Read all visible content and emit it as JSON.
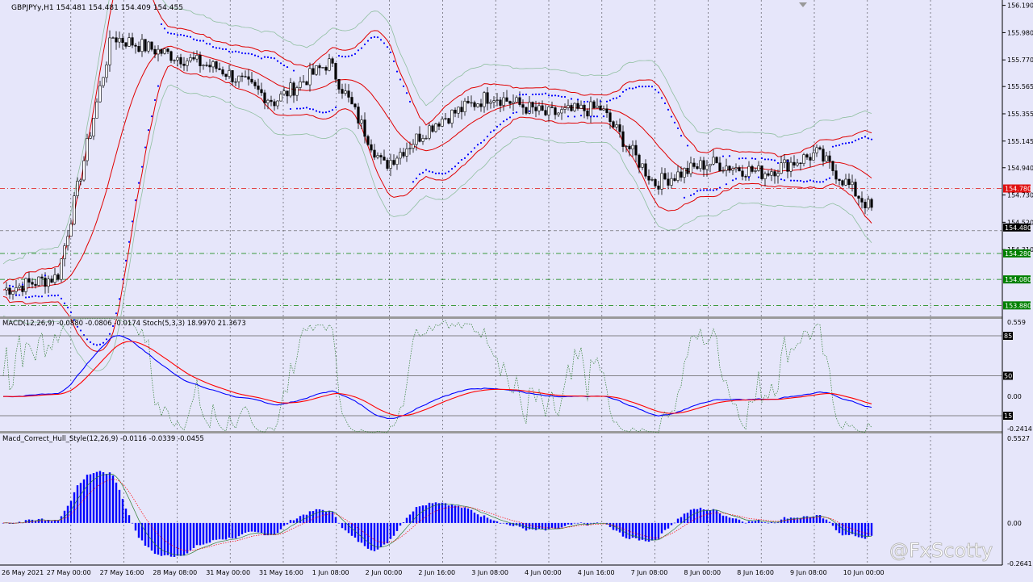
{
  "colors": {
    "background": "#e6e6fa",
    "bull_candle": "#ffffff",
    "bear_candle": "#000000",
    "bollinger_mid": "#e00000",
    "envelope": "#8fbf9f",
    "psar": "#0000ff",
    "macd_main": "#0000ff",
    "macd_signal": "#ff0000",
    "stoch": "#2e7d32",
    "hist": "#0000ff",
    "level_red": "#e01010",
    "level_green": "#008000",
    "grid": "#000000"
  },
  "icons": {
    "chart_shift_marker": "triangle-down-icon"
  },
  "main_panel": {
    "title": "GBPJPYy,H1  154.481 154.481 154.409 154.455",
    "price_axis": [
      "156.190",
      "155.980",
      "155.770",
      "155.565",
      "155.355",
      "155.145",
      "154.940",
      "154.730",
      "154.520",
      "154.310"
    ],
    "price_axis_values": [
      156.19,
      155.98,
      155.77,
      155.565,
      155.355,
      155.145,
      154.94,
      154.73,
      154.52,
      154.31
    ],
    "current_price": "154.480",
    "current_price_value": 154.48,
    "levels": [
      {
        "label": "154.780",
        "value": 154.78,
        "color": "#e01010",
        "style": "dashdot"
      },
      {
        "label": "154.280",
        "value": 154.28,
        "color": "#008000",
        "style": "dashdot"
      },
      {
        "label": "154.080",
        "value": 154.08,
        "color": "#008000",
        "style": "dashdot"
      },
      {
        "label": "153.880",
        "value": 153.88,
        "color": "#008000",
        "style": "dashdot"
      }
    ],
    "bid_line_value": 154.455,
    "ylim": [
      153.82,
      156.2
    ]
  },
  "macd_panel": {
    "title": "MACD(12,26,9) -0.0880 -0.0806 -0.0174  Stoch(5,3,3) 18.9970 21.3673",
    "axis_labels": [
      {
        "text": "0.559",
        "value": 0.559
      },
      {
        "text": "0.00",
        "value": 0.0
      },
      {
        "text": "-0.2414",
        "value": -0.2414
      }
    ],
    "stoch_levels": [
      {
        "text": "85",
        "value": 85
      },
      {
        "text": "50",
        "value": 50
      },
      {
        "text": "15",
        "value": 15
      }
    ],
    "ylim": [
      -0.2414,
      0.559
    ]
  },
  "hull_panel": {
    "title": "Macd_Correct_Hull_Style(12,26,9) -0.0116 -0.0339 -0.0455",
    "axis_labels": [
      {
        "text": "0.5527",
        "value": 0.5527
      },
      {
        "text": "0.00",
        "value": 0.0
      },
      {
        "text": "-0.2641",
        "value": -0.2641
      }
    ],
    "ylim": [
      -0.2641,
      0.5527
    ]
  },
  "time_axis": [
    "26 May 2021",
    "27 May 00:00",
    "27 May 16:00",
    "28 May 08:00",
    "31 May 00:00",
    "31 May 16:00",
    "1 Jun 08:00",
    "2 Jun 00:00",
    "2 Jun 16:00",
    "3 Jun 08:00",
    "4 Jun 00:00",
    "4 Jun 16:00",
    "7 Jun 08:00",
    "8 Jun 00:00",
    "8 Jun 16:00",
    "9 Jun 08:00",
    "10 Jun 00:00"
  ],
  "watermark": "@FxScotty",
  "chart_data": {
    "type": "line",
    "title": "GBPJPYy,H1  154.481 154.481 154.409 154.455",
    "x": [
      "26 May 2021",
      "27 May 00:00",
      "27 May 16:00",
      "28 May 08:00",
      "31 May 00:00",
      "31 May 16:00",
      "1 Jun 08:00",
      "2 Jun 00:00",
      "2 Jun 16:00",
      "3 Jun 08:00",
      "4 Jun 00:00",
      "4 Jun 16:00",
      "7 Jun 08:00",
      "8 Jun 00:00",
      "8 Jun 16:00",
      "9 Jun 08:00",
      "10 Jun 00:00"
    ],
    "series": [
      {
        "values": [
          154.0,
          154.1,
          155.95,
          155.82,
          155.7,
          155.45,
          155.75,
          154.95,
          155.3,
          155.5,
          155.35,
          155.4,
          154.82,
          154.98,
          154.9,
          155.05,
          154.62
        ]
      }
    ],
    "ylim": [
      153.82,
      156.2
    ],
    "grid": true
  }
}
